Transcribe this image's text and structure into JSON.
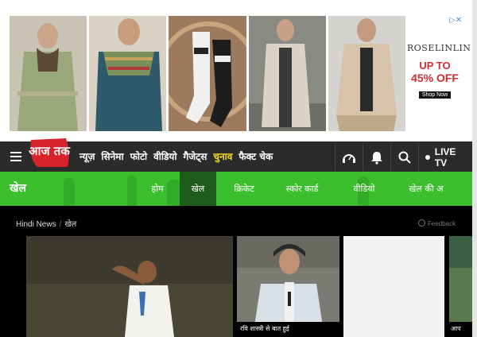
{
  "ad": {
    "brand": "ROSELINLIN",
    "offer_line1": "UP TO",
    "offer_line2": "45% OFF",
    "cta": "Shop Now",
    "close_glyph": "▷✕"
  },
  "nav": {
    "logo_text": "आज तक",
    "links": [
      {
        "label": "न्यूज़"
      },
      {
        "label": "सिनेमा"
      },
      {
        "label": "फोटो"
      },
      {
        "label": "वीडियो"
      },
      {
        "label": "गैजेट्स"
      },
      {
        "label": "चुनाव"
      },
      {
        "label": "फैक्ट चेक"
      }
    ],
    "live_label": "LIVE TV"
  },
  "section": {
    "title": "खेल",
    "tabs": [
      {
        "label": "होम"
      },
      {
        "label": "खेल"
      },
      {
        "label": "क्रिकेट"
      },
      {
        "label": "स्कोर कार्ड"
      },
      {
        "label": "वीडियो"
      },
      {
        "label": "खेल की अ"
      }
    ]
  },
  "breadcrumb": {
    "home": "Hindi News",
    "sep": "/",
    "current": "खेल"
  },
  "feedback_label": "Feedback",
  "cards": {
    "second_caption": "रवि शास्त्री से बात हुई",
    "fourth_caption": "आप"
  },
  "colors": {
    "nav_bg": "#2b2b2b",
    "sport_green": "#3cbf2f",
    "active_tab": "#1f5c1b",
    "logo_red": "#d8232a",
    "highlight_yellow": "#f5d71c"
  }
}
